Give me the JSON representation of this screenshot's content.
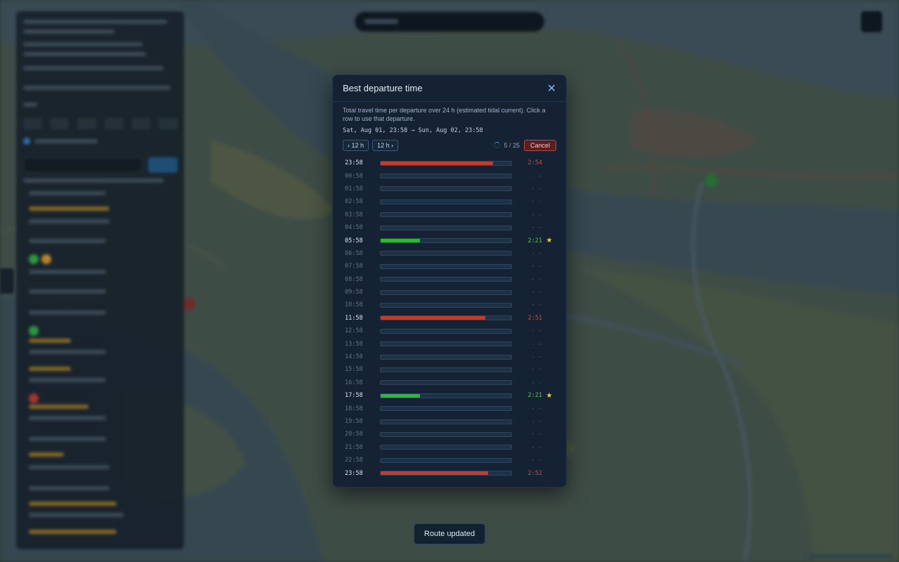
{
  "colors": {
    "bar_red": "#c63b30",
    "bar_green": "#2bb934",
    "val_red": "#cf4a3e",
    "val_green": "#4cc94a",
    "star": "#f2cf3a"
  },
  "modal": {
    "title": "Best departure time",
    "close_icon": "close-icon",
    "description": "Total travel time per departure over 24 h (estimated tidal current). Click a row to use that departure.",
    "range": "Sat, Aug 01, 23:58 → Sun, Aug 02, 23:58",
    "prev_label": "‹ 12 h",
    "next_label": "12 h ›",
    "progress": "5 / 25",
    "cancel_label": "Cancel",
    "rows": [
      {
        "time": "23:58",
        "value": "2:54",
        "fill": 0.86,
        "color": "red",
        "star": false,
        "done": true
      },
      {
        "time": "00:58",
        "value": "- -",
        "fill": 0,
        "color": "none",
        "star": false,
        "done": false
      },
      {
        "time": "01:58",
        "value": "- -",
        "fill": 0,
        "color": "none",
        "star": false,
        "done": false
      },
      {
        "time": "02:58",
        "value": "- -",
        "fill": 0,
        "color": "none",
        "star": false,
        "done": false
      },
      {
        "time": "03:58",
        "value": "- -",
        "fill": 0,
        "color": "none",
        "star": false,
        "done": false
      },
      {
        "time": "04:58",
        "value": "- -",
        "fill": 0,
        "color": "none",
        "star": false,
        "done": false
      },
      {
        "time": "05:58",
        "value": "2:21",
        "fill": 0.3,
        "color": "green",
        "star": true,
        "done": true
      },
      {
        "time": "06:58",
        "value": "- -",
        "fill": 0,
        "color": "none",
        "star": false,
        "done": false
      },
      {
        "time": "07:58",
        "value": "- -",
        "fill": 0,
        "color": "none",
        "star": false,
        "done": false
      },
      {
        "time": "08:58",
        "value": "- -",
        "fill": 0,
        "color": "none",
        "star": false,
        "done": false
      },
      {
        "time": "09:58",
        "value": "- -",
        "fill": 0,
        "color": "none",
        "star": false,
        "done": false
      },
      {
        "time": "10:58",
        "value": "- -",
        "fill": 0,
        "color": "none",
        "star": false,
        "done": false
      },
      {
        "time": "11:58",
        "value": "2:51",
        "fill": 0.8,
        "color": "red",
        "star": false,
        "done": true
      },
      {
        "time": "12:58",
        "value": "- -",
        "fill": 0,
        "color": "none",
        "star": false,
        "done": false
      },
      {
        "time": "13:58",
        "value": "- -",
        "fill": 0,
        "color": "none",
        "star": false,
        "done": false
      },
      {
        "time": "14:58",
        "value": "- -",
        "fill": 0,
        "color": "none",
        "star": false,
        "done": false
      },
      {
        "time": "15:58",
        "value": "- -",
        "fill": 0,
        "color": "none",
        "star": false,
        "done": false
      },
      {
        "time": "16:58",
        "value": "- -",
        "fill": 0,
        "color": "none",
        "star": false,
        "done": false
      },
      {
        "time": "17:58",
        "value": "2:21",
        "fill": 0.3,
        "color": "green",
        "star": true,
        "done": true
      },
      {
        "time": "18:58",
        "value": "- -",
        "fill": 0,
        "color": "none",
        "star": false,
        "done": false
      },
      {
        "time": "19:58",
        "value": "- -",
        "fill": 0,
        "color": "none",
        "star": false,
        "done": false
      },
      {
        "time": "20:58",
        "value": "- -",
        "fill": 0,
        "color": "none",
        "star": false,
        "done": false
      },
      {
        "time": "21:58",
        "value": "- -",
        "fill": 0,
        "color": "none",
        "star": false,
        "done": false
      },
      {
        "time": "22:58",
        "value": "- -",
        "fill": 0,
        "color": "none",
        "star": false,
        "done": false
      },
      {
        "time": "23:58",
        "value": "2:52",
        "fill": 0.82,
        "color": "red",
        "star": false,
        "done": true
      }
    ],
    "star_glyph": "★"
  },
  "toast": {
    "text": "Route updated"
  }
}
